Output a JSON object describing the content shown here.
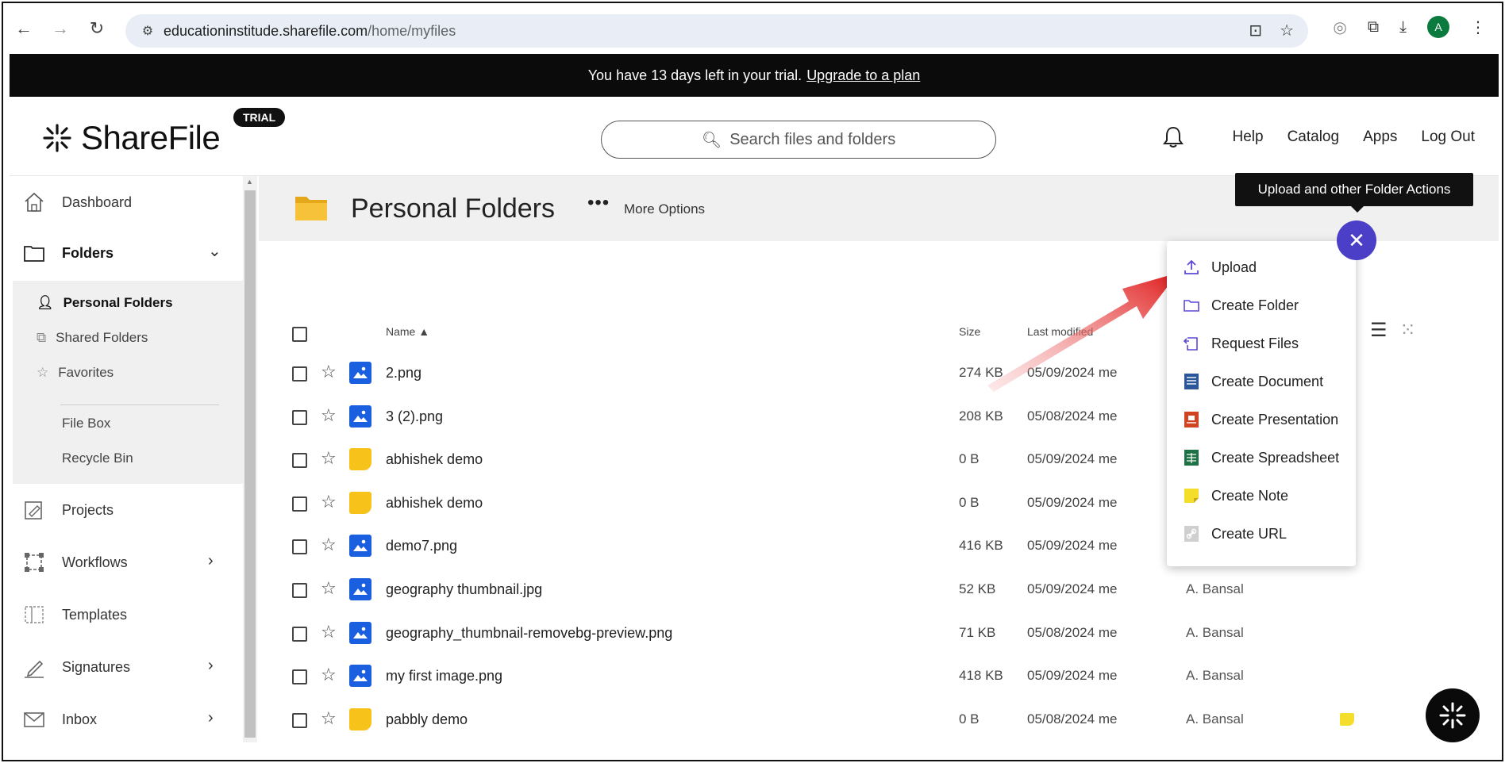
{
  "browser": {
    "url_domain": "educationinstitude.sharefile.com",
    "url_path": "/home/myfiles",
    "profile_initial": "A"
  },
  "banner": {
    "text": "You have 13 days left in your trial.",
    "link": "Upgrade to a plan"
  },
  "header": {
    "logo_text": "ShareFile",
    "badge": "TRIAL",
    "search_placeholder": "Search files and folders",
    "nav": [
      "Help",
      "Catalog",
      "Apps",
      "Log Out"
    ]
  },
  "sidebar": {
    "dashboard": "Dashboard",
    "folders": "Folders",
    "personal_folders": "Personal Folders",
    "shared_folders": "Shared Folders",
    "favorites": "Favorites",
    "file_box": "File Box",
    "recycle_bin": "Recycle Bin",
    "projects": "Projects",
    "workflows": "Workflows",
    "templates": "Templates",
    "signatures": "Signatures",
    "inbox": "Inbox"
  },
  "main": {
    "title": "Personal Folders",
    "more_options": "More Options",
    "columns": {
      "name": "Name",
      "size": "Size",
      "last_modified": "Last modified"
    },
    "files": [
      {
        "name": "2.png",
        "type": "img",
        "size": "274 KB",
        "date": "05/09/2024",
        "by": "me",
        "owner": "",
        "note": false
      },
      {
        "name": "3 (2).png",
        "type": "img",
        "size": "208 KB",
        "date": "05/08/2024",
        "by": "me",
        "owner": "",
        "note": false
      },
      {
        "name": "abhishek demo",
        "type": "note",
        "size": "0 B",
        "date": "05/09/2024",
        "by": "me",
        "owner": "",
        "note": false
      },
      {
        "name": "abhishek demo",
        "type": "note",
        "size": "0 B",
        "date": "05/09/2024",
        "by": "me",
        "owner": "",
        "note": false
      },
      {
        "name": "demo7.png",
        "type": "img",
        "size": "416 KB",
        "date": "05/09/2024",
        "by": "me",
        "owner": "",
        "note": false
      },
      {
        "name": "geography thumbnail.jpg",
        "type": "img",
        "size": "52 KB",
        "date": "05/09/2024",
        "by": "me",
        "owner": "A. Bansal",
        "note": false
      },
      {
        "name": "geography_thumbnail-removebg-preview.png",
        "type": "img",
        "size": "71 KB",
        "date": "05/08/2024",
        "by": "me",
        "owner": "A. Bansal",
        "note": false
      },
      {
        "name": "my first image.png",
        "type": "img",
        "size": "418 KB",
        "date": "05/09/2024",
        "by": "me",
        "owner": "A. Bansal",
        "note": false
      },
      {
        "name": "pabbly demo",
        "type": "note",
        "size": "0 B",
        "date": "05/08/2024",
        "by": "me",
        "owner": "A. Bansal",
        "note": true
      }
    ]
  },
  "actions": {
    "tooltip": "Upload and other Folder Actions",
    "close_glyph": "✕",
    "menu": [
      {
        "label": "Upload",
        "icon": "upload-icon"
      },
      {
        "label": "Create Folder",
        "icon": "folder-outline-icon"
      },
      {
        "label": "Request Files",
        "icon": "request-files-icon"
      },
      {
        "label": "Create Document",
        "icon": "document-icon"
      },
      {
        "label": "Create Presentation",
        "icon": "presentation-icon"
      },
      {
        "label": "Create Spreadsheet",
        "icon": "spreadsheet-icon"
      },
      {
        "label": "Create Note",
        "icon": "note-icon"
      },
      {
        "label": "Create URL",
        "icon": "url-icon"
      }
    ]
  },
  "colors": {
    "accent": "#4a3fc6",
    "image_icon": "#1a5fe0",
    "note_icon": "#f7c31a",
    "arrow": "#e01b1b"
  }
}
